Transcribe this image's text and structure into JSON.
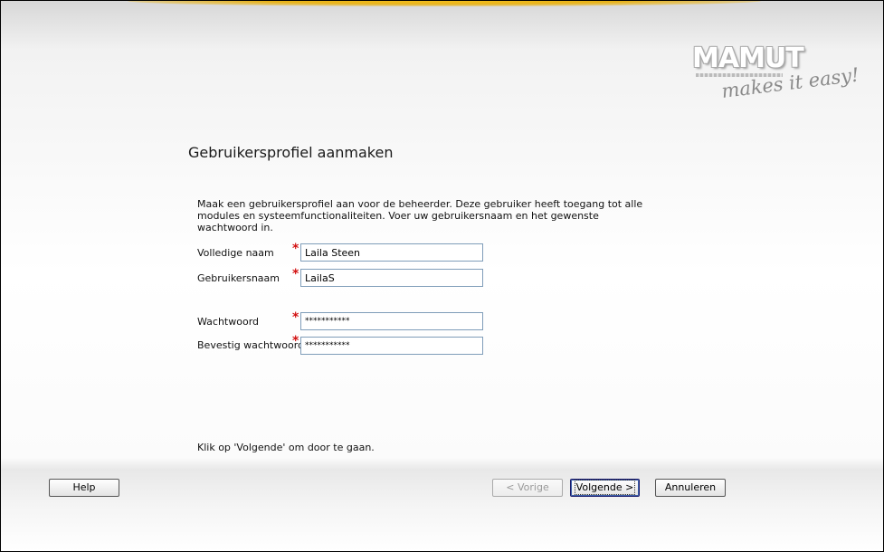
{
  "logo": {
    "brand": "MAMUT",
    "tagline": "makes it easy!"
  },
  "page": {
    "title": "Gebruikersprofiel aanmaken",
    "intro": "Maak een gebruikersprofiel aan voor de beheerder. Deze gebruiker heeft toegang tot alle modules en systeemfunctionaliteiten. Voer uw gebruikersnaam en het gewenste wachtwoord in.",
    "hint": "Klik op 'Volgende' om door te gaan."
  },
  "form": {
    "required_mark": "*",
    "full_name": {
      "label": "Volledige naam",
      "value": "Laila Steen"
    },
    "username": {
      "label": "Gebruikersnaam",
      "value": "LailaS"
    },
    "password": {
      "label": "Wachtwoord",
      "value": "***********"
    },
    "confirm_password": {
      "label": "Bevestig wachtwoord",
      "value": "***********"
    }
  },
  "buttons": {
    "help": "Help",
    "previous": "< Vorige",
    "next": "Volgende >",
    "cancel": "Annuleren"
  },
  "colors": {
    "required": "#d21010",
    "accent": "#f5c020",
    "field_border": "#7f9db9"
  }
}
